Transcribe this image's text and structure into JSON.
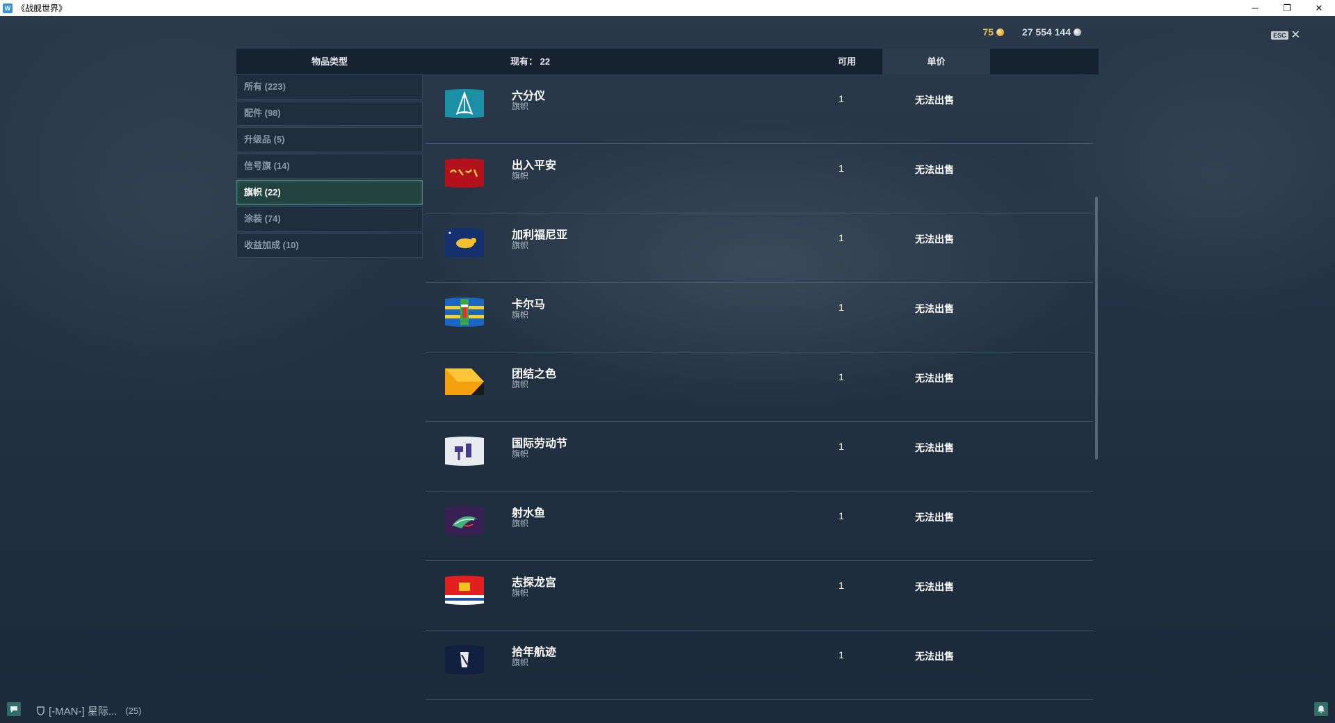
{
  "window": {
    "title": "《战舰世界》",
    "controls": {
      "minimize": "─",
      "restore": "❐",
      "close": "✕"
    }
  },
  "currency": {
    "doubloons": "75",
    "credits": "27 554 144"
  },
  "esc": {
    "key": "ESC",
    "close": "✕"
  },
  "header": {
    "category": "物品类型",
    "owned": "现有：  22",
    "available": "可用",
    "unit_price": "单价"
  },
  "categories": [
    {
      "label": "所有 (223)",
      "active": false
    },
    {
      "label": "配件 (98)",
      "active": false
    },
    {
      "label": "升级品 (5)",
      "active": false
    },
    {
      "label": "信号旗 (14)",
      "active": false
    },
    {
      "label": "旗帜 (22)",
      "active": true
    },
    {
      "label": "涂装 (74)",
      "active": false
    },
    {
      "label": "收益加成 (10)",
      "active": false
    }
  ],
  "items": [
    {
      "name": "六分仪",
      "type": "旗帜",
      "available": "1",
      "price": "无法出售",
      "icon": "sextant-flag-icon"
    },
    {
      "name": "出入平安",
      "type": "旗帜",
      "available": "1",
      "price": "无法出售",
      "icon": "red-calligraphy-flag-icon"
    },
    {
      "name": "加利福尼亚",
      "type": "旗帜",
      "available": "1",
      "price": "无法出售",
      "icon": "california-bear-flag-icon"
    },
    {
      "name": "卡尔马",
      "type": "旗帜",
      "available": "1",
      "price": "无法出售",
      "icon": "kalmar-flag-icon"
    },
    {
      "name": "团结之色",
      "type": "旗帜",
      "available": "1",
      "price": "无法出售",
      "icon": "unity-colors-flag-icon"
    },
    {
      "name": "国际劳动节",
      "type": "旗帜",
      "available": "1",
      "price": "无法出售",
      "icon": "labor-day-flag-icon"
    },
    {
      "name": "射水鱼",
      "type": "旗帜",
      "available": "1",
      "price": "无法出售",
      "icon": "archerfish-flag-icon"
    },
    {
      "name": "志探龙宫",
      "type": "旗帜",
      "available": "1",
      "price": "无法出售",
      "icon": "dragon-palace-flag-icon"
    },
    {
      "name": "拾年航迹",
      "type": "旗帜",
      "available": "1",
      "price": "无法出售",
      "icon": "ten-years-flag-icon"
    }
  ],
  "bottom": {
    "division": "[-MAN-]  星际...",
    "count": "(25)"
  },
  "colors": {
    "accent_active": "#3f8a7c",
    "gold": "#f2c14e",
    "background": "#223243"
  }
}
